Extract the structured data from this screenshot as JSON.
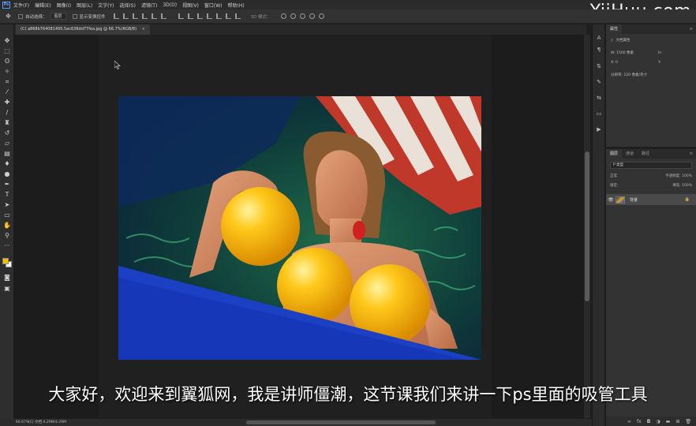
{
  "watermark": "YiiHuu.com",
  "menubar": {
    "logo": "Ps",
    "items": [
      "文件(F)",
      "编辑(E)",
      "图像(I)",
      "图层(L)",
      "文字(Y)",
      "选择(S)",
      "滤镜(T)",
      "3D(D)",
      "视图(V)",
      "窗口(W)",
      "帮助(H)"
    ]
  },
  "options": {
    "auto_select_label": "自动选择：",
    "auto_select_value": "图层",
    "show_transform_label": "显示变换控件",
    "mode_3d_label": "3D 模式："
  },
  "document": {
    "tab_title": "(C) a868b764081495.5ac636dd77fea.jpg @ 66.7%(RGB/8)",
    "close": "×"
  },
  "status": {
    "zoom": "66.67%",
    "doc_info": "(C) 文档:4.29M/4.29M"
  },
  "properties": {
    "tab": "属性",
    "doc_props": "文档属性",
    "w_label": "W:",
    "w_value": "1500 像素",
    "h_label": "H:",
    "x_label": "X:",
    "x_value": "0",
    "y_label": "Y:",
    "resolution": "分辨率: 120 像素/英寸"
  },
  "layers": {
    "tabs": [
      "图层",
      "通道",
      "路径"
    ],
    "search": "P 类型",
    "blend_mode": "正常",
    "opacity": "不透明度: 100%",
    "lock_label": "锁定:",
    "fill": "填充: 100%",
    "layer_name": "背景"
  },
  "subtitle": "大家好，欢迎来到翼狐网，我是讲师僵潮，这节课我们来讲一下ps里面的吸管工具",
  "colors": {
    "foreground": "#f0c000",
    "background": "#ffffff",
    "accent": "#5aa0ff"
  },
  "tool_icons": [
    "move-icon",
    "marquee-icon",
    "lasso-icon",
    "magic-wand-icon",
    "crop-icon",
    "eyedropper-icon",
    "healing-brush-icon",
    "brush-icon",
    "clone-stamp-icon",
    "history-brush-icon",
    "eraser-icon",
    "gradient-icon",
    "blur-icon",
    "dodge-icon",
    "pen-icon",
    "type-icon",
    "path-select-icon",
    "rectangle-icon",
    "hand-icon",
    "zoom-icon",
    "more-tools-icon"
  ]
}
